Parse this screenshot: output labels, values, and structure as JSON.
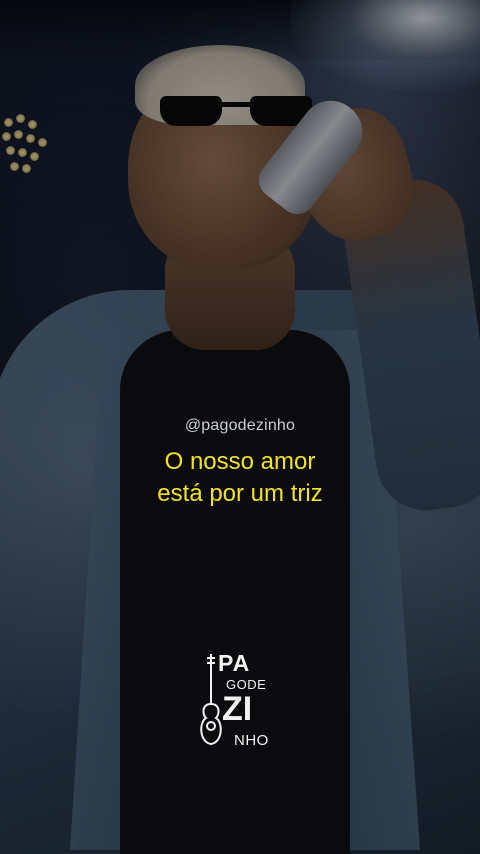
{
  "overlay": {
    "handle": "@pagodezinho",
    "lyrics": [
      "O nosso amor",
      "está por um triz"
    ]
  },
  "logo": {
    "line1": "PA",
    "line2": "GODE",
    "line3": "ZI",
    "line4": "NHO"
  },
  "colors": {
    "lyrics": "#f2e32a",
    "handle": "#c9ced6",
    "logo": "#f2f2f2"
  },
  "icons": [
    "guitar-icon"
  ]
}
